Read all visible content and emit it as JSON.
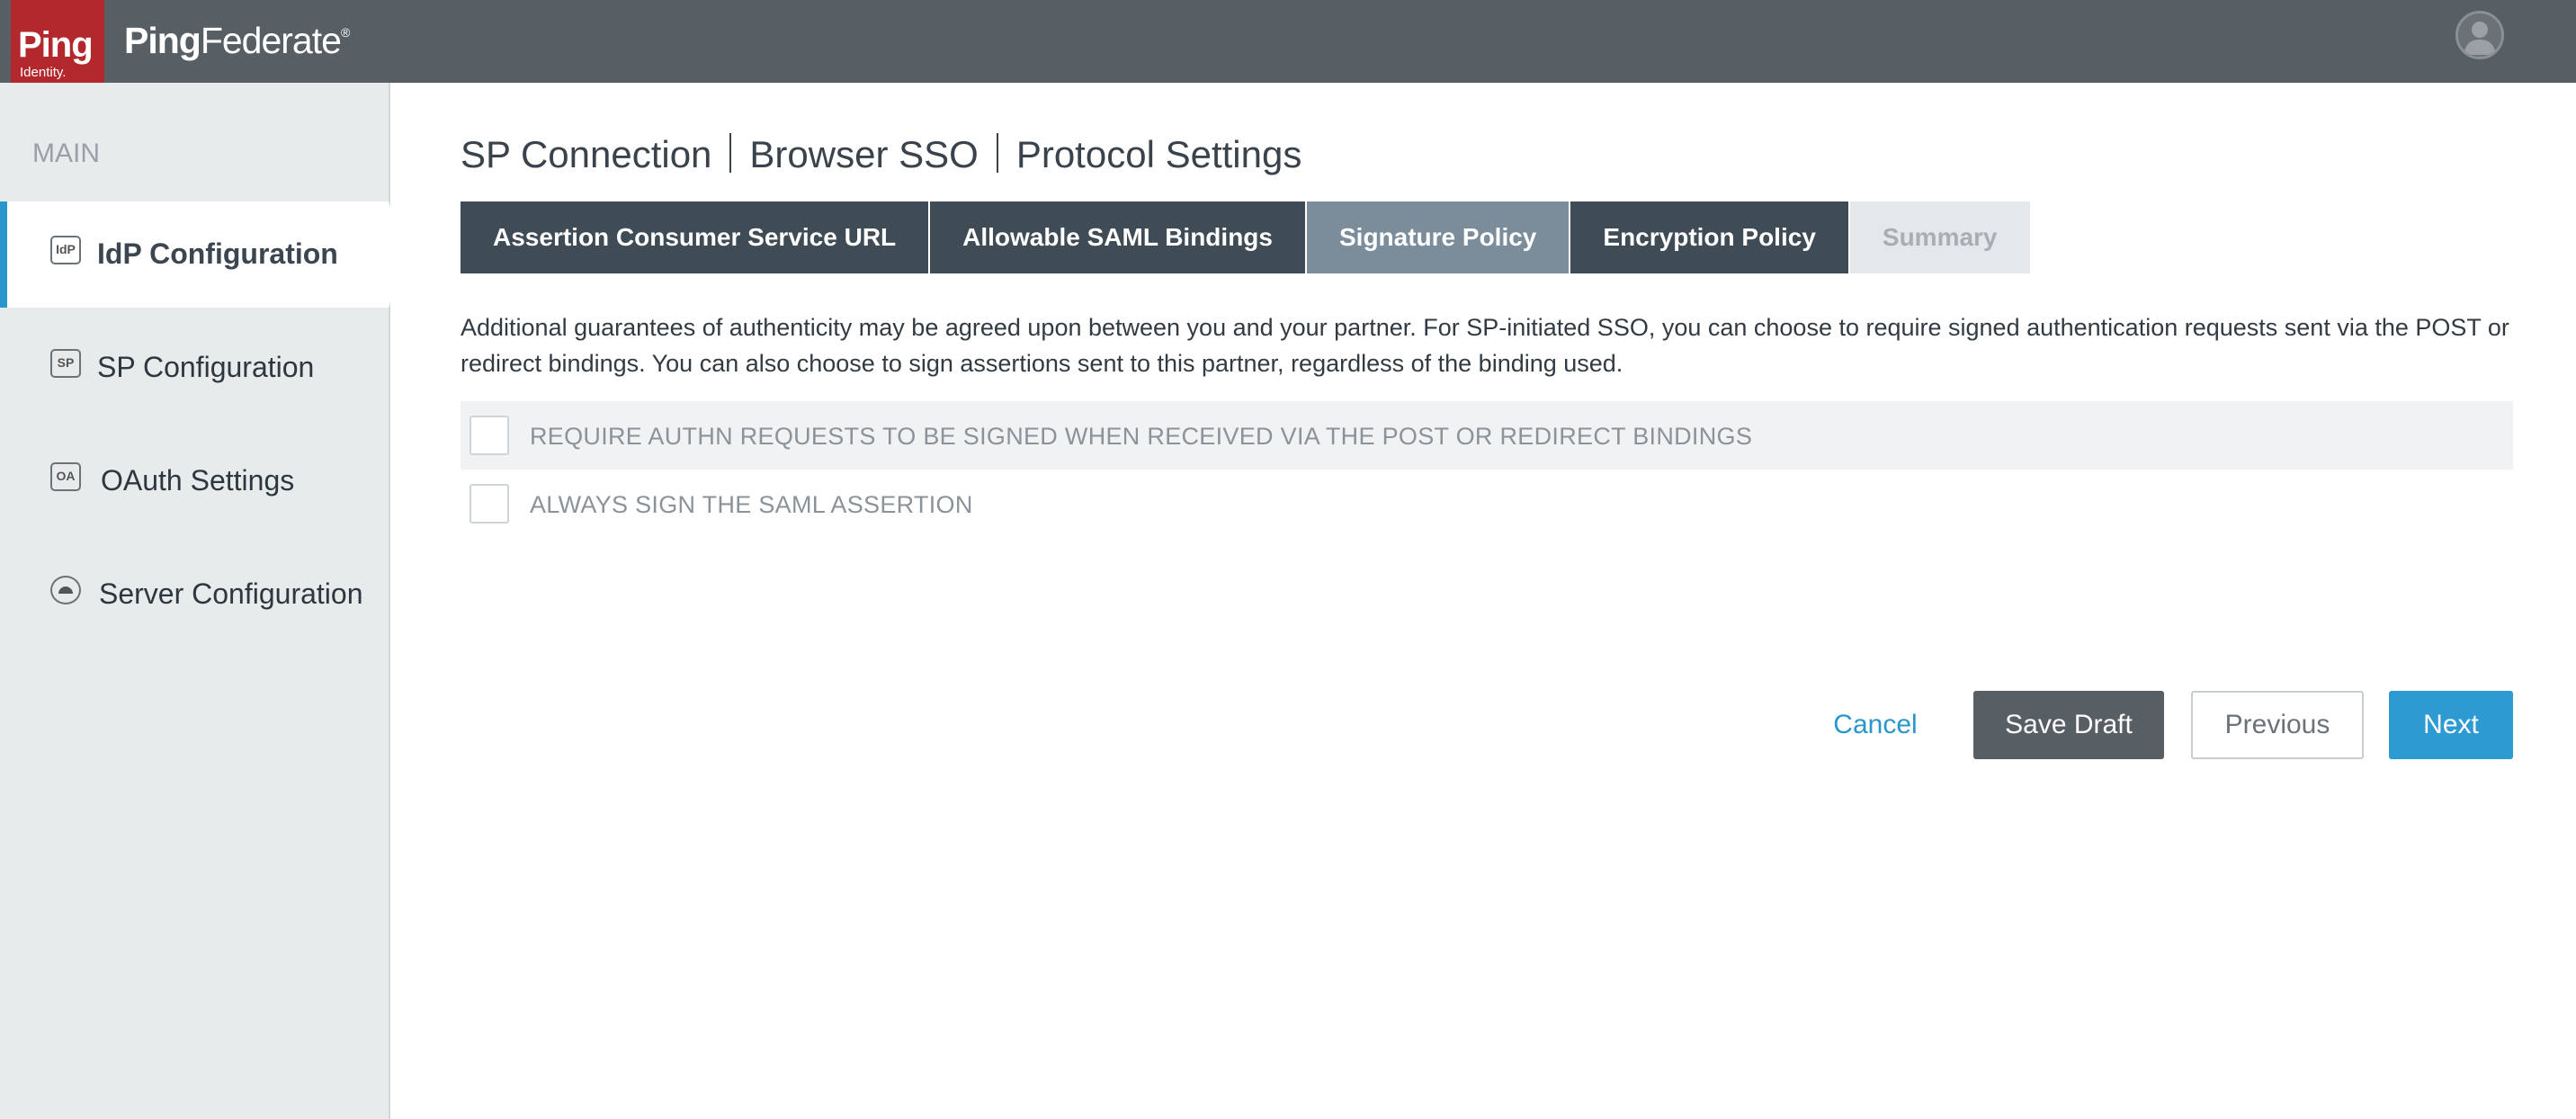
{
  "header": {
    "logo_ping": "Ping",
    "logo_identity": "Identity.",
    "product_ping": "Ping",
    "product_federate": "Federate",
    "product_mark": "®"
  },
  "sidebar": {
    "section_label": "MAIN",
    "items": [
      {
        "label": "IdP Configuration",
        "icon_text": "IdP",
        "icon": "idp-icon"
      },
      {
        "label": "SP Configuration",
        "icon_text": "SP",
        "icon": "sp-icon"
      },
      {
        "label": "OAuth Settings",
        "icon_text": "OA",
        "icon": "oauth-icon"
      },
      {
        "label": "Server Configuration",
        "icon_text": "",
        "icon": "server-icon"
      }
    ]
  },
  "main": {
    "breadcrumb": [
      "SP Connection",
      "Browser SSO",
      "Protocol Settings"
    ],
    "tabs": [
      {
        "label": "Assertion Consumer Service URL",
        "state": "default"
      },
      {
        "label": "Allowable SAML Bindings",
        "state": "default"
      },
      {
        "label": "Signature Policy",
        "state": "current"
      },
      {
        "label": "Encryption Policy",
        "state": "default"
      },
      {
        "label": "Summary",
        "state": "disabled"
      }
    ],
    "description": "Additional guarantees of authenticity may be agreed upon between you and your partner. For SP-initiated SSO, you can choose to require signed authentication requests sent via the POST or redirect bindings. You can also choose to sign assertions sent to this partner, regardless of the binding used.",
    "options": [
      {
        "label": "REQUIRE AUTHN REQUESTS TO BE SIGNED WHEN RECEIVED VIA THE POST OR REDIRECT BINDINGS",
        "checked": false
      },
      {
        "label": "ALWAYS SIGN THE SAML ASSERTION",
        "checked": false
      }
    ]
  },
  "actions": {
    "cancel": "Cancel",
    "save_draft": "Save Draft",
    "previous": "Previous",
    "next": "Next"
  },
  "colors": {
    "header_bg": "#575e64",
    "brand_red": "#b3282d",
    "accent_blue": "#2996cc",
    "tab_dark": "#3f4b55",
    "tab_current": "#7b8d9b"
  }
}
